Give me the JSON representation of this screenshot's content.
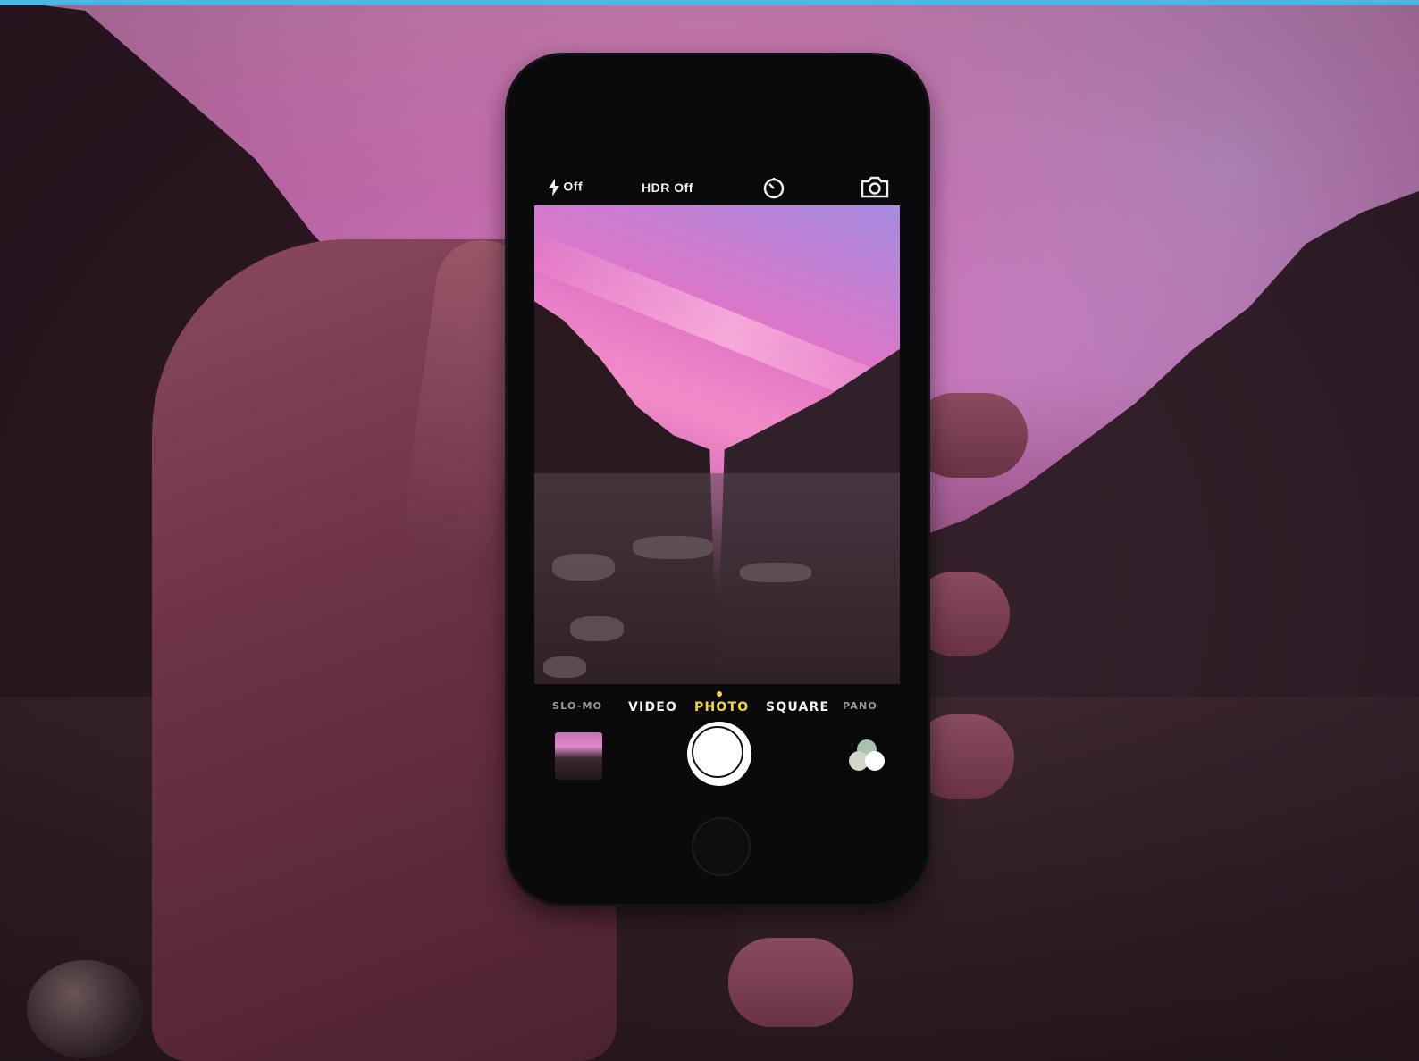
{
  "camera_app": {
    "top_controls": {
      "flash_label": "Off",
      "hdr_label": "HDR Off",
      "timer_icon": "timer-icon",
      "flip_icon": "camera-flip-icon"
    },
    "modes": {
      "slo_mo": "SLO-MO",
      "video": "VIDEO",
      "photo": "PHOTO",
      "square": "SQUARE",
      "pano": "PANO",
      "selected": "PHOTO"
    },
    "bottom_controls": {
      "thumbnail_icon": "last-photo-thumbnail",
      "shutter_icon": "shutter-button",
      "filters_icon": "filters-icon"
    }
  },
  "colors": {
    "accent_selected_mode": "#f5d63a",
    "top_bar": "#49b8e6",
    "control_text": "#f2f2f2",
    "inactive_mode": "#9a9a9a"
  }
}
